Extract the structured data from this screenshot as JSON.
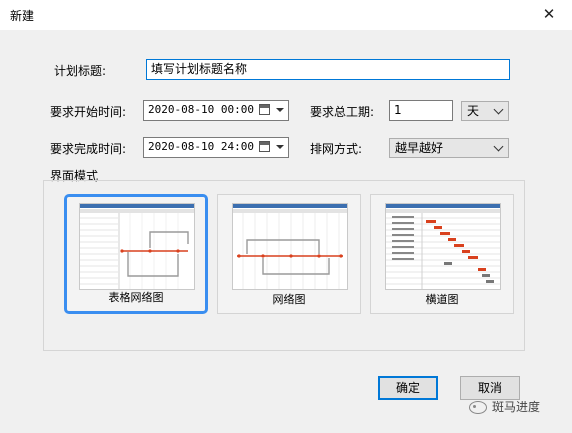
{
  "window": {
    "title": "新建",
    "close_glyph": "✕"
  },
  "form": {
    "plan_title_label": "计划标题:",
    "plan_title_value": "填写计划标题名称",
    "start_label": "要求开始时间:",
    "start_value": "2020-08-10 00:00",
    "duration_label": "要求总工期:",
    "duration_value": "1",
    "duration_unit": "天",
    "finish_label": "要求完成时间:",
    "finish_value": "2020-08-10 24:00",
    "schedule_label": "排网方式:",
    "schedule_value": "越早越好"
  },
  "modes": {
    "group_title": "界面模式",
    "items": [
      {
        "label": "表格网络图",
        "selected": true
      },
      {
        "label": "网络图",
        "selected": false
      },
      {
        "label": "横道图",
        "selected": false
      }
    ]
  },
  "buttons": {
    "ok": "确定",
    "cancel": "取消"
  },
  "watermark": {
    "text": "斑马进度"
  },
  "colors": {
    "accent": "#0078d7",
    "selection": "#3a8ef0",
    "critical_path": "#d9411e",
    "thumb_header": "#3c6fb0"
  }
}
